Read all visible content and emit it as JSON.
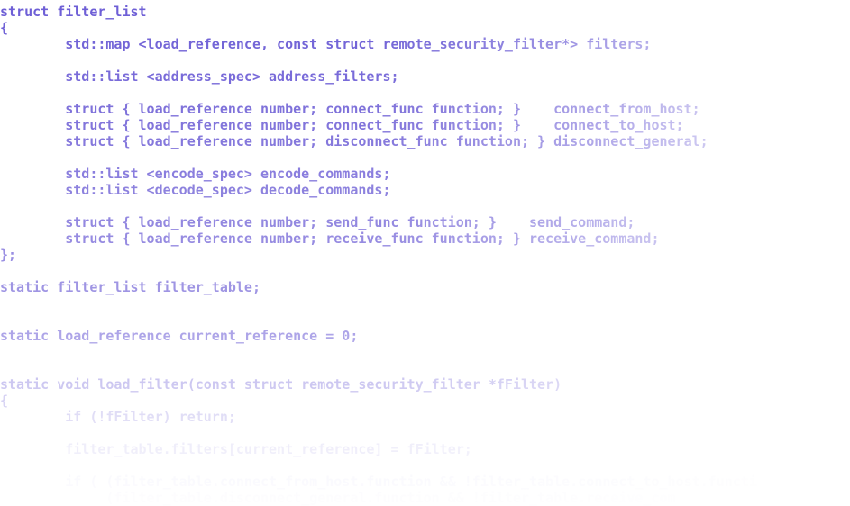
{
  "code": {
    "lines": [
      "struct filter_list",
      "{",
      "        std::map <load_reference, const struct remote_security_filter*> filters;",
      "",
      "        std::list <address_spec> address_filters;",
      "",
      "        struct { load_reference number; connect_func function; }    connect_from_host;",
      "        struct { load_reference number; connect_func function; }    connect_to_host;",
      "        struct { load_reference number; disconnect_func function; } disconnect_general;",
      "",
      "        std::list <encode_spec> encode_commands;",
      "        std::list <decode_spec> decode_commands;",
      "",
      "        struct { load_reference number; send_func function; }    send_command;",
      "        struct { load_reference number; receive_func function; } receive_command;",
      "};",
      "",
      "static filter_list filter_table;",
      "",
      "",
      "static load_reference current_reference = 0;",
      "",
      "",
      "static void load_filter(const struct remote_security_filter *fFilter)",
      "{",
      "        if (!fFilter) return;",
      "",
      "        filter_table.filters[current_reference] = fFilter;",
      "",
      "        if ( (filter_table.connect_from_host.function && !filter_table.connect_to_host.functi",
      "             (filter_table.disconnect_general.function && !filter_table.receive_com"
    ]
  },
  "colors": {
    "code_text": "#6e5fd6",
    "background": "#ffffff"
  }
}
